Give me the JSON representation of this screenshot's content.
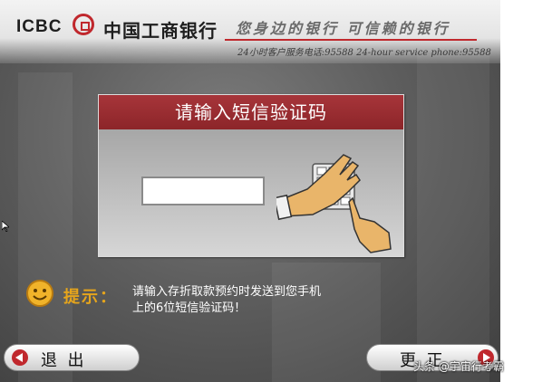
{
  "header": {
    "brand_latin": "ICBC",
    "brand_name": "中国工商银行",
    "slogan": "您身边的银行 可信赖的银行",
    "hotline": "24小时客户服务电话:95588 24-hour service phone:95588"
  },
  "dialog": {
    "title": "请输入短信验证码",
    "input_value": ""
  },
  "hint": {
    "label": "提示：",
    "line1": "请输入存折取款预约时发送到您手机",
    "line2": "上的6位短信验证码！"
  },
  "buttons": {
    "exit_label": "退  出",
    "next_label": "更  正"
  },
  "watermark": "头条 @宇宙行考霸",
  "colors": {
    "brand_red": "#c0282d",
    "dialog_title_bg": "#9b2f33",
    "hint_label": "#e6a51c"
  }
}
